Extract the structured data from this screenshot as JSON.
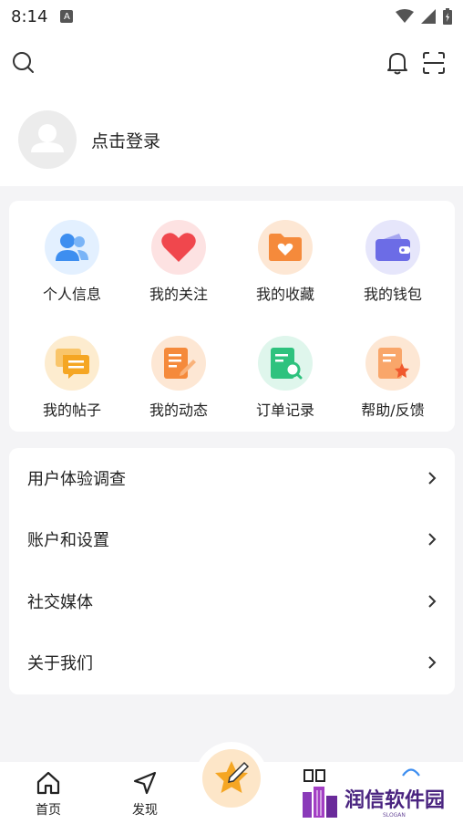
{
  "status_bar": {
    "time": "8:14",
    "a_badge": "A"
  },
  "header": {
    "search_icon": "search-icon",
    "bell_icon": "bell-icon",
    "scan_icon": "scan-icon"
  },
  "profile": {
    "login_label": "点击登录"
  },
  "menu_grid": [
    {
      "label": "个人信息",
      "icon": "user-info-icon",
      "bg": "#e3f0ff",
      "color": "#3d8ef0"
    },
    {
      "label": "我的关注",
      "icon": "heart-icon",
      "bg": "#fde2e2",
      "color": "#f0474d"
    },
    {
      "label": "我的收藏",
      "icon": "folder-heart-icon",
      "bg": "#fde7d4",
      "color": "#f58a3b"
    },
    {
      "label": "我的钱包",
      "icon": "wallet-icon",
      "bg": "#e6e6fb",
      "color": "#6c6ce6"
    },
    {
      "label": "我的帖子",
      "icon": "chat-icon",
      "bg": "#fdeccf",
      "color": "#f5a623"
    },
    {
      "label": "我的动态",
      "icon": "edit-doc-icon",
      "bg": "#fde7d4",
      "color": "#f58a3b"
    },
    {
      "label": "订单记录",
      "icon": "order-search-icon",
      "bg": "#dff6ec",
      "color": "#2ec27e"
    },
    {
      "label": "帮助/反馈",
      "icon": "doc-star-icon",
      "bg": "#fde7d4",
      "color": "#f58a3b"
    }
  ],
  "settings_list": [
    {
      "label": "用户体验调查"
    },
    {
      "label": "账户和设置"
    },
    {
      "label": "社交媒体"
    },
    {
      "label": "关于我们"
    }
  ],
  "tabbar": {
    "home": "首页",
    "discover": "发现"
  },
  "watermark": {
    "text": "润信软件园",
    "sub": "SLOGAN"
  }
}
